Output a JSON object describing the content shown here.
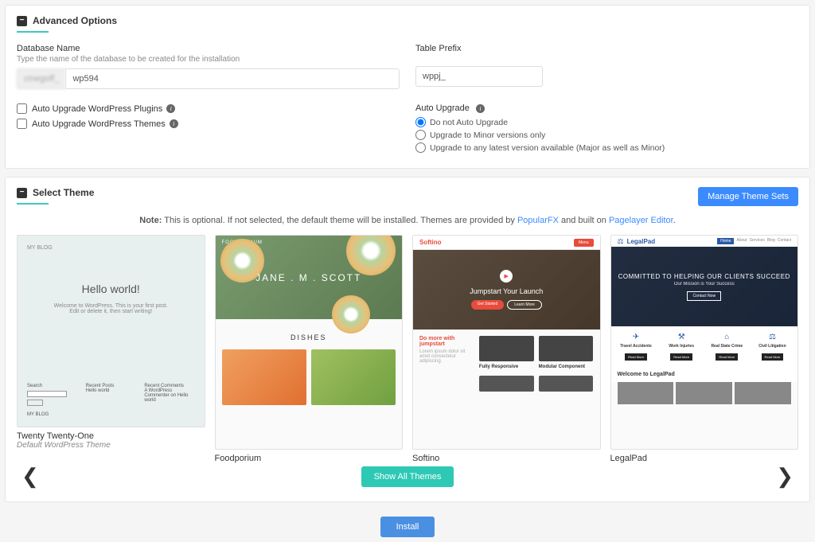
{
  "advanced": {
    "title": "Advanced Options",
    "dbname_label": "Database Name",
    "dbname_hint": "Type the name of the database to be created for the installation",
    "dbname_prefix": "cinegoff_",
    "dbname_value": "wp594",
    "tableprefix_label": "Table Prefix",
    "tableprefix_value": "wppj_",
    "auto_plugins": "Auto Upgrade WordPress Plugins",
    "auto_themes": "Auto Upgrade WordPress Themes",
    "auto_upgrade_label": "Auto Upgrade",
    "upg_opts": [
      "Do not Auto Upgrade",
      "Upgrade to Minor versions only",
      "Upgrade to any latest version available (Major as well as Minor)"
    ]
  },
  "themes": {
    "title": "Select Theme",
    "manage_btn": "Manage Theme Sets",
    "note_bold": "Note:",
    "note_text": " This is optional. If not selected, the default theme will be installed. Themes are provided by ",
    "link1": "PopularFX",
    "note_mid": " and built on ",
    "link2": "Pagelayer Editor",
    "items": [
      {
        "name": "Twenty Twenty-One",
        "sub": "Default WordPress Theme"
      },
      {
        "name": "Foodporium",
        "sub": ""
      },
      {
        "name": "Softino",
        "sub": ""
      },
      {
        "name": "LegalPad",
        "sub": ""
      }
    ],
    "show_all": "Show All Themes"
  },
  "install_btn": "Install",
  "preview": {
    "t1_blog": "MY BLOG",
    "t1_title": "Hello world!",
    "t2_brand": "FOODPORIUM",
    "t2_name": "JANE . M . SCOTT",
    "t2_dishes": "DISHES",
    "t3_logo": "Softino",
    "t3_hero": "Jumpstart Your Launch",
    "t3_more": "Do more with jumpstart",
    "t4_logo": "LegalPad",
    "t4_hero": "COMMITTED TO HELPING OUR CLIENTS SUCCEED",
    "t4_sub": "Our Mission is Your Success",
    "t4_wel": "Welcome to LegalPad",
    "t4_svc": [
      "Travel Accidents",
      "Work Injuries",
      "Real State Crime",
      "Civil Litigation"
    ]
  }
}
